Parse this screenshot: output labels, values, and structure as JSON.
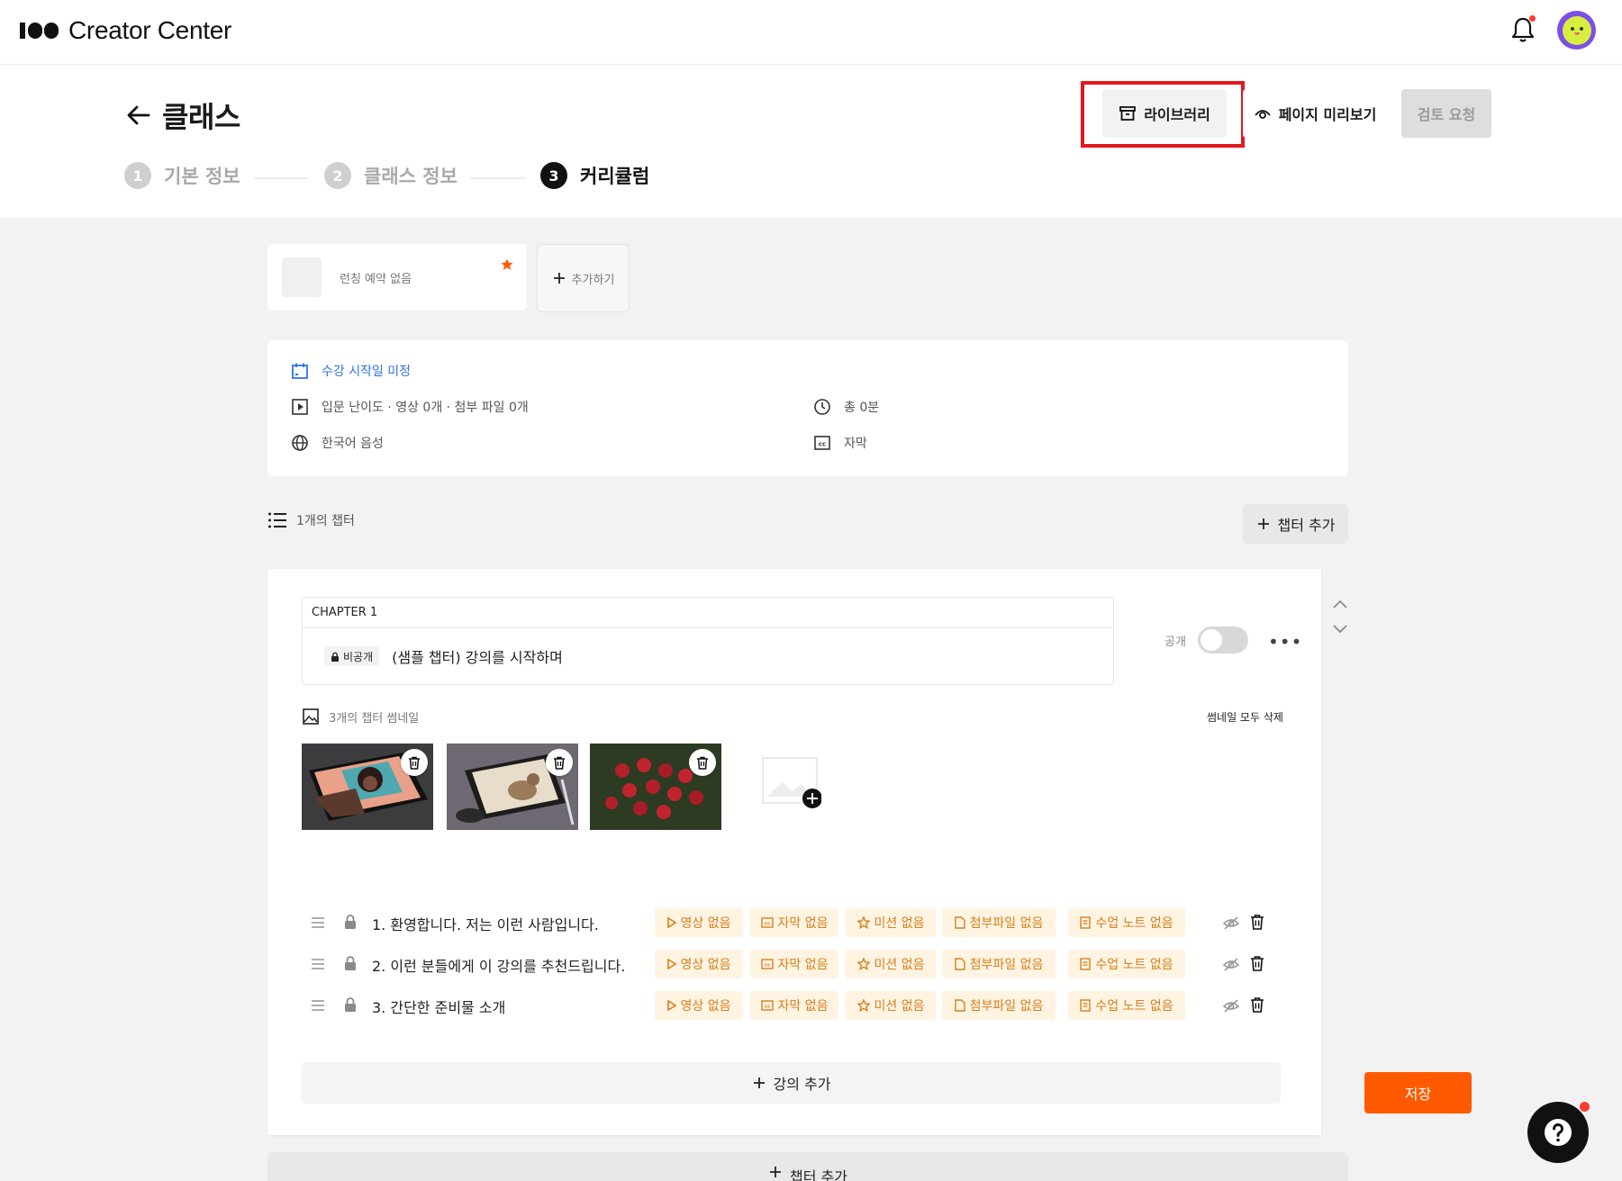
{
  "app": {
    "name": "Creator Center"
  },
  "header": {
    "title": "클래스",
    "library_label": "라이브러리",
    "preview_label": "페이지 미리보기",
    "review_label": "검토 요청"
  },
  "steps": [
    {
      "num": "1",
      "label": "기본 정보",
      "state": "done"
    },
    {
      "num": "2",
      "label": "클래스 정보",
      "state": "done"
    },
    {
      "num": "3",
      "label": "커리큘럼",
      "state": "active"
    }
  ],
  "launch": {
    "status": "런칭 예약 없음",
    "add_label": "추가하기"
  },
  "info": {
    "start_date": "수강 시작일 미정",
    "summary": "입문 난이도 · 영상 0개 · 첨부 파일 0개",
    "language": "한국어 음성",
    "duration": "총 0분",
    "subtitle": "자막"
  },
  "chapters_count": "1개의 챕터",
  "chapter_add_label": "챕터 추가",
  "chapter": {
    "label": "CHAPTER 1",
    "privacy_badge": "비공개",
    "title": "(샘플 챕터) 강의를 시작하며",
    "public_label": "공개",
    "public_on": false,
    "thumb_label": "3개의 챕터 썸네일",
    "thumb_delete_all": "썸네일 모두 삭제",
    "thumbnails": [
      "tablet-portrait-drawing",
      "tablet-cat-drawing",
      "red-roses-pattern"
    ]
  },
  "lesson_tags": [
    "영상 없음",
    "자막 없음",
    "미션 없음",
    "첨부파일 없음",
    "수업 노트 없음"
  ],
  "lessons": [
    {
      "title": "1. 환영합니다. 저는 이런 사람입니다."
    },
    {
      "title": "2. 이런 분들에게 이 강의를 추천드립니다."
    },
    {
      "title": "3. 간단한 준비물 소개"
    }
  ],
  "lesson_add_label": "강의 추가",
  "save_label": "저장",
  "colors": {
    "accent": "#ff5a00",
    "tag_bg": "#fff3e2",
    "tag_text": "#d7801a",
    "link": "#2f73e8",
    "highlight": "#e4171e"
  }
}
